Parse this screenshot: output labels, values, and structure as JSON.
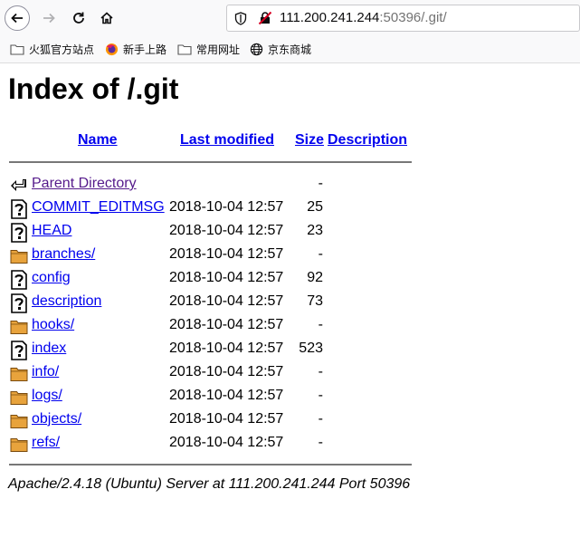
{
  "browser": {
    "url_host": "111.200.241.244",
    "url_rest": ":50396/.git/",
    "bookmarks": [
      "火狐官方站点",
      "新手上路",
      "常用网址",
      "京东商城"
    ]
  },
  "page": {
    "title": "Index of /.git",
    "columns": {
      "name": "Name",
      "last_modified": "Last modified",
      "size": "Size",
      "description": "Description"
    },
    "parent": {
      "name": "Parent Directory",
      "size": "-"
    },
    "rows": [
      {
        "name": "COMMIT_EDITMSG",
        "date": "2018-10-04 12:57",
        "size": "25",
        "icon": "unknown-file-icon"
      },
      {
        "name": "HEAD",
        "date": "2018-10-04 12:57",
        "size": "23",
        "icon": "unknown-file-icon"
      },
      {
        "name": "branches/",
        "date": "2018-10-04 12:57",
        "size": "-",
        "icon": "folder-icon"
      },
      {
        "name": "config",
        "date": "2018-10-04 12:57",
        "size": "92",
        "icon": "unknown-file-icon"
      },
      {
        "name": "description",
        "date": "2018-10-04 12:57",
        "size": "73",
        "icon": "unknown-file-icon"
      },
      {
        "name": "hooks/",
        "date": "2018-10-04 12:57",
        "size": "-",
        "icon": "folder-icon"
      },
      {
        "name": "index",
        "date": "2018-10-04 12:57",
        "size": "523",
        "icon": "unknown-file-icon"
      },
      {
        "name": "info/",
        "date": "2018-10-04 12:57",
        "size": "-",
        "icon": "folder-icon"
      },
      {
        "name": "logs/",
        "date": "2018-10-04 12:57",
        "size": "-",
        "icon": "folder-icon"
      },
      {
        "name": "objects/",
        "date": "2018-10-04 12:57",
        "size": "-",
        "icon": "folder-icon"
      },
      {
        "name": "refs/",
        "date": "2018-10-04 12:57",
        "size": "-",
        "icon": "folder-icon"
      }
    ],
    "address": "Apache/2.4.18 (Ubuntu) Server at 111.200.241.244 Port 50396"
  },
  "colors": {
    "link": "#0000ee",
    "visited": "#551a8b",
    "folder": "#e8a33c"
  }
}
